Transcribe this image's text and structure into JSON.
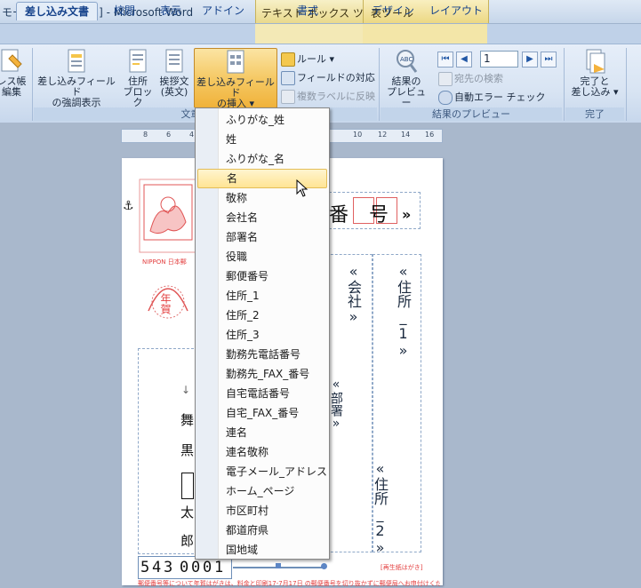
{
  "window": {
    "title": "モード] [互換モード] - Microsoft Word"
  },
  "context_tabs": {
    "text_box_tools": "テキスト ボックス ツール",
    "table_tools": "表ツール"
  },
  "tabs": [
    {
      "label": "差し込み文書"
    },
    {
      "label": "校閲"
    },
    {
      "label": "表示"
    },
    {
      "label": "アドイン"
    },
    {
      "label": "書式"
    },
    {
      "label": "デザイン"
    },
    {
      "label": "レイアウト"
    }
  ],
  "ribbon": {
    "address_book_line1": "レス帳",
    "address_book_line2": "編集",
    "highlight_fields_line1": "差し込みフィールド",
    "highlight_fields_line2": "の強調表示",
    "address_block_line1": "住所",
    "address_block_line2": "ブロック",
    "greeting_line1": "挨拶文",
    "greeting_line2": "(英文)",
    "insert_field_line1": "差し込みフィールド",
    "insert_field_line2": "の挿入",
    "rules": "ルール",
    "match_fields": "フィールドの対応",
    "update_labels": "複数ラベルに反映",
    "preview_line1": "結果の",
    "preview_line2": "プレビュー",
    "record_number": "1",
    "find_recipient": "宛先の検索",
    "auto_check": "自動エラー チェック",
    "finish_line1": "完了と",
    "finish_line2": "差し込み",
    "group_write": "文章入力と",
    "group_preview": "結果のプレビュー",
    "group_finish": "完了"
  },
  "ruler": {
    "ticks": [
      "8",
      "6",
      "4",
      "2",
      "10",
      "12",
      "14",
      "16"
    ]
  },
  "document": {
    "anchor": "⚓",
    "zip_field_top": "番 号",
    "zip_field_close": "»",
    "company_field": "«会社»",
    "address1_field": "«住所_1»",
    "department_field": "«部署»",
    "address2_field": "«住所_2»",
    "name_chars": [
      "舞",
      "黒",
      "太",
      "郎"
    ],
    "stamp_caption": "NIPPON 日本郵",
    "stamp_nenga": "年賀",
    "postal_digits": [
      "5",
      "4",
      "3",
      "0",
      "0",
      "0",
      "1"
    ],
    "fine_print_right": "[再生紙はがき]",
    "fine_print_bottom": "郵便番号等について年賀はがきは、料金と印刷17-7月17日 の郵便番号を切り抜かずに郵便局へお申付けください。"
  },
  "menu": {
    "items": [
      "ふりがな_姓",
      "姓",
      "ふりがな_名",
      "名",
      "敬称",
      "会社名",
      "部署名",
      "役職",
      "郵便番号",
      "住所_1",
      "住所_2",
      "住所_3",
      "勤務先電話番号",
      "勤務先_FAX_番号",
      "自宅電話番号",
      "自宅_FAX_番号",
      "連名",
      "連名敬称",
      "電子メール_アドレス",
      "ホーム_ページ",
      "市区町村",
      "都道府県",
      "国地域"
    ],
    "hovered_index": 3
  }
}
